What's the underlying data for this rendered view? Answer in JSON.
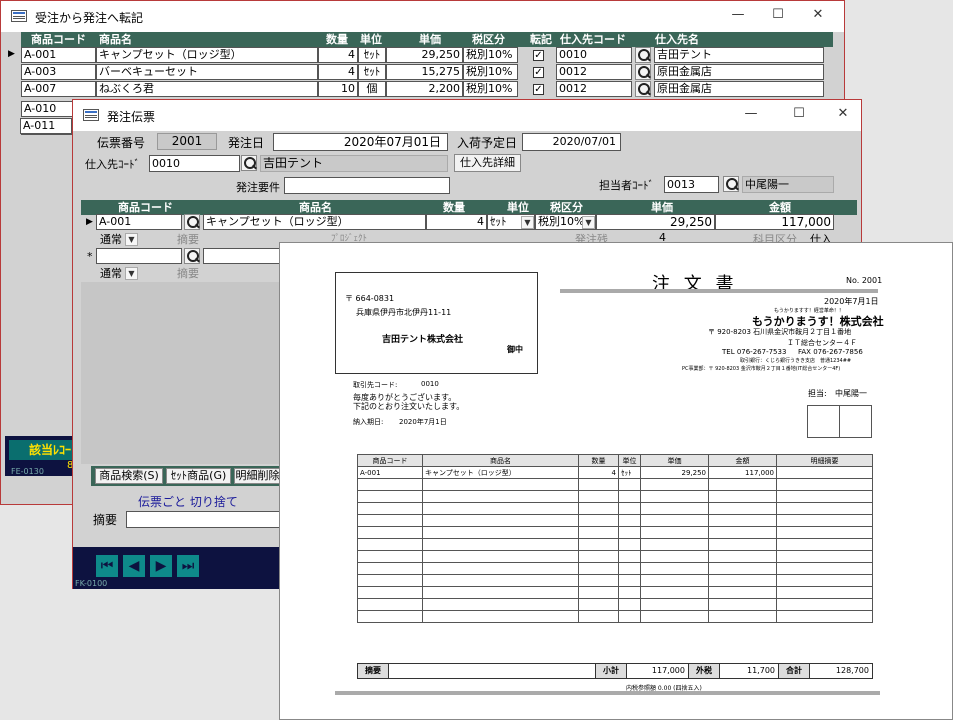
{
  "win1": {
    "title": "受注から発注へ転記",
    "controls": {
      "min": "—",
      "max": "☐",
      "close": "✕"
    },
    "columns": [
      "商品コード",
      "商品名",
      "数量",
      "単位",
      "単価",
      "税区分",
      "転記",
      "仕入先コード",
      "仕入先名"
    ],
    "rows": [
      {
        "code": "A-001",
        "name": "キャンプセット（ロッジ型）",
        "qty": "4",
        "unit": "ｾｯﾄ",
        "price": "29,250",
        "tax": "税別10%",
        "check": "✓",
        "supplier_code": "0010",
        "supplier": "吉田テント"
      },
      {
        "code": "A-003",
        "name": "バーベキューセット",
        "qty": "4",
        "unit": "ｾｯﾄ",
        "price": "15,275",
        "tax": "税別10%",
        "check": "✓",
        "supplier_code": "0012",
        "supplier": "原田金属店"
      },
      {
        "code": "A-007",
        "name": "ねぶくろ君",
        "qty": "10",
        "unit": "個",
        "price": "2,200",
        "tax": "税別10%",
        "check": "✓",
        "supplier_code": "0012",
        "supplier": "原田金属店"
      },
      {
        "code": "A-010"
      },
      {
        "code": "A-011"
      }
    ],
    "footer_label": "該当ﾚｺｰ",
    "footer_sub": "8",
    "form_id": "FE-0130"
  },
  "win2": {
    "title": "発注伝票",
    "controls": {
      "min": "—",
      "max": "☐",
      "close": "✕"
    },
    "slip_no_label": "伝票番号",
    "slip_no": "2001",
    "order_date_label": "発注日",
    "order_date": "2020年07月01日",
    "arrival_label": "入荷予定日",
    "arrival_date": "2020/07/01",
    "supplier_code_label": "仕入先ｺｰﾄﾞ",
    "supplier_code": "0010",
    "supplier_name": "吉田テント",
    "supplier_detail_button": "仕入先詳細",
    "order_req_label": "発注要件",
    "staff_label": "担当者ｺｰﾄﾞ",
    "staff_code": "0013",
    "staff_name": "中尾陽一",
    "columns": [
      "商品コード",
      "商品名",
      "数量",
      "単位",
      "税区分",
      "単価",
      "金額"
    ],
    "line": {
      "code": "A-001",
      "name": "キャンプセット（ロッジ型）",
      "qty": "4",
      "unit": "ｾｯﾄ",
      "tax": "税別10%",
      "price": "29,250",
      "amount": "117,000"
    },
    "sub": {
      "type": "通常",
      "memo_label": "摘要",
      "project_label": "ﾌﾟﾛｼﾞｪｸﾄ",
      "remaining_label": "発注残",
      "remaining": "4",
      "subject_label": "科目区分",
      "subject": "仕入"
    },
    "new_row_marker": "*",
    "new_sub": {
      "type": "通常",
      "memo_label": "摘要"
    },
    "tabs": [
      "商品検索(S)",
      "ｾｯﾄ商品(G)",
      "明細削除"
    ],
    "rounding_label": "伝票ごと 切り捨て",
    "memo_label": "摘要",
    "form_id": "FK-0100"
  },
  "doc": {
    "title": "注 文 書",
    "doc_no": "No. 2001",
    "date": "2020年7月1日",
    "postal": "〒 664-0831",
    "address": "兵庫県伊丹市北伊丹11-11",
    "to_company": "吉田テント株式会社",
    "honorific": "御中",
    "catch": "もうかりますす！経営革命！！",
    "company": "もうかりまうす！株式会社",
    "company_addr1": "〒 920-8203 石川県金沢市鞍月２丁目１番地",
    "company_addr2": "ＩＴ総合センター４Ｆ",
    "tel": "TEL 076-267-7533",
    "fax": "FAX 076-267-7856",
    "bank": "取引銀行：くじら銀行うきき支店　普通1234##",
    "office": "PC事業部：〒 920-8203 金沢市鞍月２丁目１番地(IT総合センター4F)",
    "client_code_label": "取引先コード:",
    "client_code": "0010",
    "greeting1": "毎度ありがとうございます。",
    "greeting2": "下記のとおり注文いたします。",
    "delivery_label": "納入期日:",
    "delivery_date": "2020年7月1日",
    "staff_label": "担当:",
    "staff": "中尾陽一",
    "columns": [
      "商品コード",
      "商品名",
      "数量",
      "単位",
      "単価",
      "金額",
      "明細摘要"
    ],
    "line": {
      "code": "A-001",
      "name": "キャンプセット（ロッジ型）",
      "qty": "4",
      "unit": "ｾｯﾄ",
      "price": "29,250",
      "amount": "117,000"
    },
    "memo_label": "摘要",
    "subtotal_label": "小計",
    "subtotal": "117,000",
    "tax_label": "外税",
    "tax": "11,700",
    "total_label": "合計",
    "total": "128,700",
    "note": "内税参照額 0.00 (四捨五入)"
  },
  "colors": {
    "header_green": "#3a6658",
    "navy_bar": "#0d1240",
    "nav_arrow": "#0e8a8a",
    "window_border": "#b83a3a"
  }
}
